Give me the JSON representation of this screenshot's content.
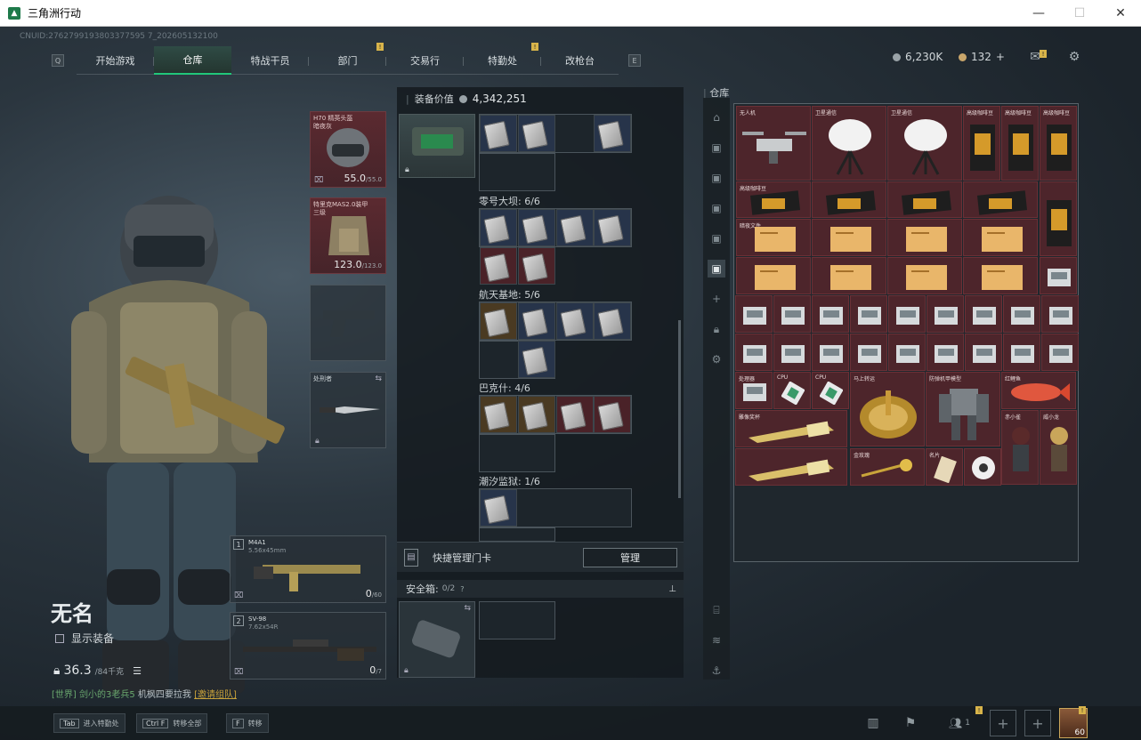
{
  "window": {
    "title": "三角洲行动",
    "minimize": "—",
    "maximize": "☐",
    "close": "✕"
  },
  "uid": "CNUID:2762799193803377595 7_202605132100",
  "nav": {
    "left_key": "Q",
    "right_key": "E",
    "tabs": [
      {
        "label": "开始游戏"
      },
      {
        "label": "仓库",
        "active": true
      },
      {
        "label": "特战干员"
      },
      {
        "label": "部门",
        "badge": "!"
      },
      {
        "label": "交易行"
      },
      {
        "label": "特勤处",
        "badge": "!"
      },
      {
        "label": "改枪台"
      }
    ]
  },
  "currency": {
    "silver": "6,230K",
    "gold": "132",
    "gold_plus": "+"
  },
  "character": {
    "name": "无名",
    "show_equipment": "显示装备",
    "weight": "36.3",
    "weight_max": "/84千克",
    "helmet": {
      "label": "H70 精英头盔\n暗夜灰",
      "dur": "55.0",
      "dur_max": "/55.0"
    },
    "armor": {
      "label": "特里克MAS2.0装甲\n三级",
      "dur": "123.0",
      "dur_max": "/123.0"
    },
    "melee": {
      "label": "处刑者"
    },
    "primary": {
      "slot": "1",
      "name": "M4A1",
      "ammo_type": "5.56x45mm",
      "ammo": "0",
      "ammo_max": "/60"
    },
    "secondary": {
      "slot": "2",
      "name": "SV-98",
      "ammo_type": "7.62x54R",
      "ammo": "0",
      "ammo_max": "/7"
    }
  },
  "chat": {
    "world": "[世界]",
    "sender": "剑小的3老兵5",
    "msg": "机枫四要拉我",
    "link": "[邀请组队]"
  },
  "mid": {
    "value_label": "装备价值",
    "value": "4,342,251",
    "sections": [
      {
        "title": "零号大坝: 6/6"
      },
      {
        "title": "航天基地: 5/6"
      },
      {
        "title": "巴克什: 4/6"
      },
      {
        "title": "潮汐监狱: 1/6"
      }
    ],
    "quick_card": "快捷管理门卡",
    "manage": "管理",
    "safe_box": "安全箱:",
    "safe_count": "0/2",
    "safe_help": "?"
  },
  "warehouse": {
    "title": "仓库",
    "items": [
      {
        "name": "无人机"
      },
      {
        "name": "卫星通信"
      },
      {
        "name": "卫星通信"
      },
      {
        "name": "高级咖啡豆"
      },
      {
        "name": "高级咖啡豆"
      },
      {
        "name": "高级咖啡豆"
      },
      {
        "name": "高级咖啡豆"
      },
      {
        "name": "暗夜文件"
      },
      {
        "name": "处理器"
      },
      {
        "name": "CPU"
      },
      {
        "name": "CPU"
      },
      {
        "name": "马上转运"
      },
      {
        "name": "防弹机甲模型"
      },
      {
        "name": "红鲤鱼"
      },
      {
        "name": "雕像奖杯"
      },
      {
        "name": "赤小雀"
      },
      {
        "name": "威小龙"
      },
      {
        "name": "金玫瑰"
      },
      {
        "name": "名片"
      }
    ]
  },
  "bottom": {
    "hints": [
      {
        "key": "Tab",
        "label": "进入特勤处"
      },
      {
        "key": "Ctrl F",
        "label": "转移全部"
      },
      {
        "key": "F",
        "label": "转移"
      }
    ],
    "party_count": "1",
    "avatar_level": "60"
  }
}
